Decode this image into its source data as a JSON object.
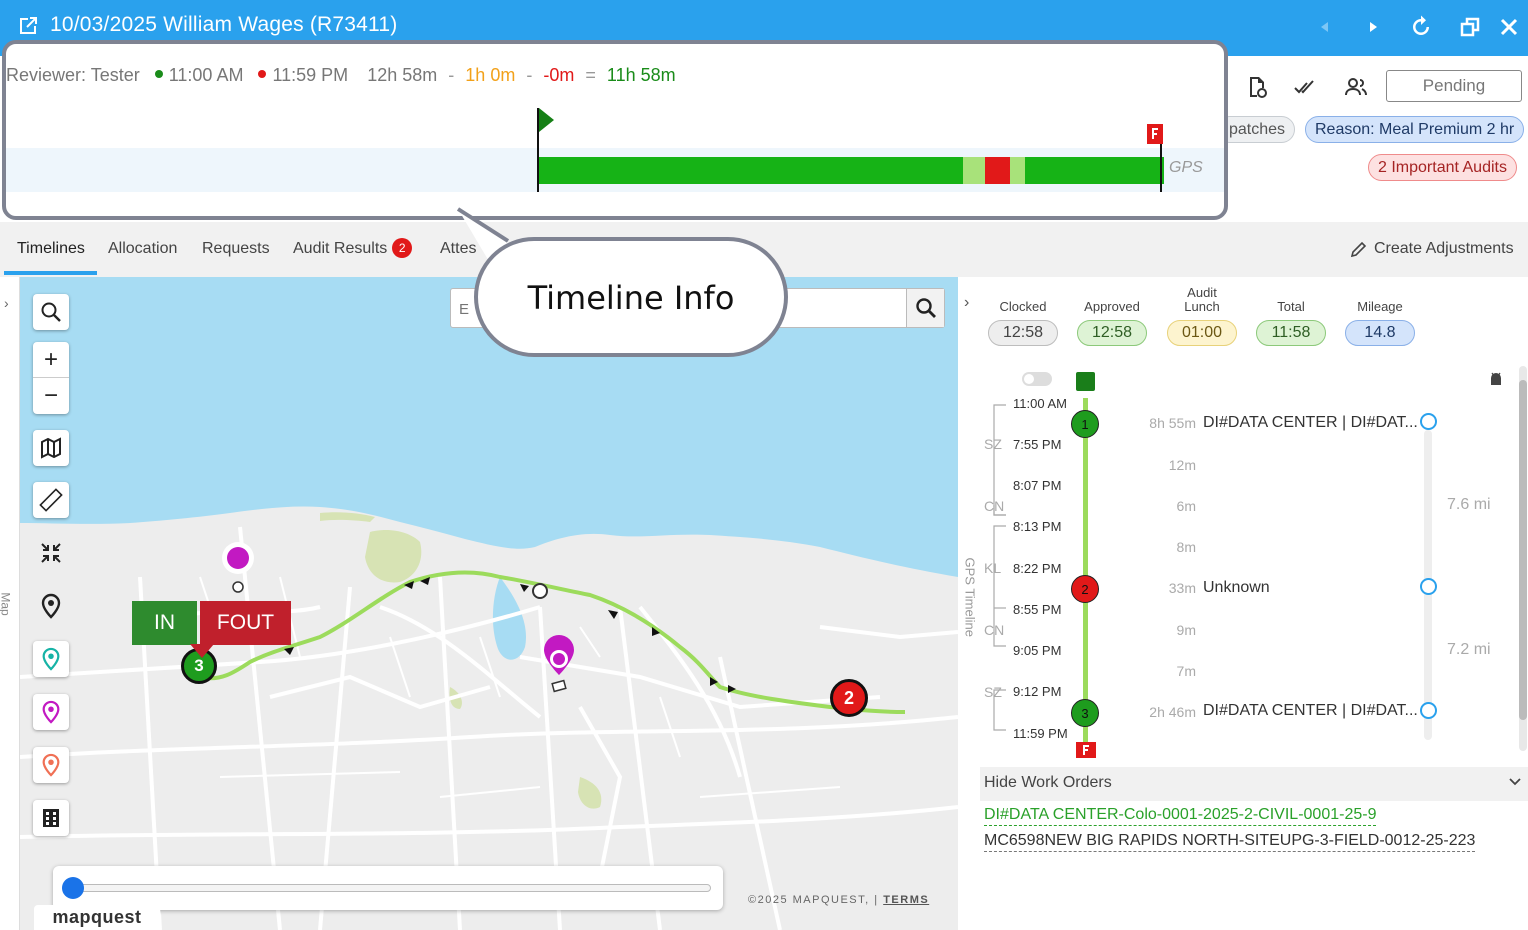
{
  "window": {
    "title": "10/03/2025 William Wages (R73411)"
  },
  "header": {
    "status_button": "Pending",
    "chips": {
      "dispatches": "patches",
      "reason": "Reason: Meal Premium 2 hr",
      "audits": "2 Important Audits"
    }
  },
  "tabs": [
    {
      "label": "Timelines"
    },
    {
      "label": "Allocation"
    },
    {
      "label": "Requests"
    },
    {
      "label": "Audit Results",
      "badge": "2"
    },
    {
      "label": "Attes"
    }
  ],
  "create_adjustments": "Create Adjustments",
  "callout": {
    "reviewer": "Reviewer: Tester",
    "start_time": "11:00 AM",
    "end_time": "11:59 PM",
    "duration": "12h 58m",
    "minus1": "-",
    "lunch": "1h 0m",
    "minus2": "-",
    "deduction": "-0m",
    "equals": "=",
    "net": "11h 58m",
    "gps_label": "GPS",
    "bubble_text": "Timeline Info",
    "start_flag_position": 0.0,
    "end_flag_position": 1.0
  },
  "map": {
    "search_placeholder": "E",
    "flag_in": "IN",
    "flag_fout": "FOUT",
    "marker_3": "3",
    "marker_2": "2",
    "copyright": "©2025 MAPQUEST,",
    "terms": "TERMS",
    "logo": "mapquest",
    "side_label": "Map",
    "gps_timeline_label": "GPS Timeline",
    "slider_value": 0
  },
  "stats": [
    {
      "label": "Clocked",
      "value": "12:58",
      "bg": "#eeeeee",
      "border": "#bdbdbd",
      "color": "#444444"
    },
    {
      "label": "Approved",
      "value": "12:58",
      "bg": "#def3d5",
      "border": "#8cc97a",
      "color": "#2e5e24"
    },
    {
      "label": "Audit Lunch",
      "value": "01:00",
      "bg": "#fdf4cf",
      "border": "#e8d27a",
      "color": "#6b5713"
    },
    {
      "label": "Total",
      "value": "11:58",
      "bg": "#def3d5",
      "border": "#8cc97a",
      "color": "#2e5e24"
    },
    {
      "label": "Mileage",
      "value": "14.8",
      "bg": "#d4e4fb",
      "border": "#8ab0e8",
      "color": "#1f3a66"
    }
  ],
  "timeline": {
    "times": [
      "11:00 AM",
      "7:55 PM",
      "8:07 PM",
      "8:13 PM",
      "8:22 PM",
      "8:55 PM",
      "9:05 PM",
      "9:12 PM",
      "11:59 PM"
    ],
    "codes": [
      "SZ",
      "CN",
      "KL",
      "CN",
      "SZ"
    ],
    "durations": [
      "8h 55m",
      "12m",
      "6m",
      "8m",
      "33m",
      "9m",
      "7m",
      "2h 46m"
    ],
    "nodes": [
      "1",
      "2",
      "3"
    ],
    "locations": [
      "DI#DATA CENTER | DI#DAT...",
      "Unknown",
      "DI#DATA CENTER | DI#DAT..."
    ],
    "miles": [
      "7.6 mi",
      "7.2 mi"
    ]
  },
  "work_orders": {
    "header": "Hide Work Orders",
    "items": [
      {
        "label": "DI#DATA CENTER-Colo-0001-2025-2-CIVIL-0001-25-9",
        "color": "#2aa12a"
      },
      {
        "label": "MC6598NEW BIG RAPIDS NORTH-SITEUPG-3-FIELD-0012-25-223",
        "color": "#333333"
      }
    ]
  }
}
